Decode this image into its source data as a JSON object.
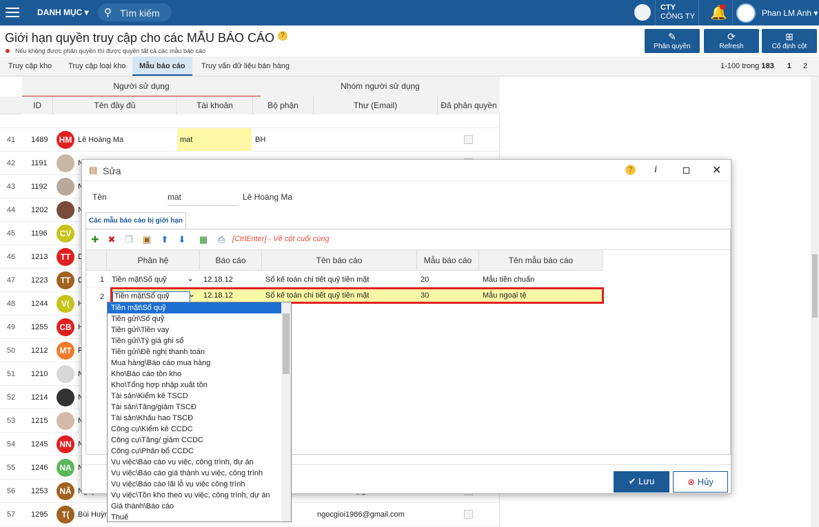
{
  "topbar": {
    "menu_label": "DANH MỤC",
    "search_placeholder": "Tìm kiếm",
    "company_line1": "CTY",
    "company_line2": "CÔNG TY",
    "user_name": "Phan LM Anh"
  },
  "page": {
    "title": "Giới hạn quyền truy cập cho các MẪU BÁO CÁO",
    "subtitle": "Nếu không được phân quyền thì được quyền tất cả các mẫu báo cáo"
  },
  "header_buttons": [
    {
      "label": "Phân quyền",
      "icon": "pencil-icon"
    },
    {
      "label": "Refresh",
      "icon": "refresh-icon"
    },
    {
      "label": "Cố định cột",
      "icon": "pin-columns-icon"
    }
  ],
  "tabs": [
    "Truy cập kho",
    "Truy cập loại kho",
    "Mẫu báo cáo",
    "Truy vấn dữ liệu bán hàng"
  ],
  "paging": {
    "range": "1-100 trong",
    "total": "183",
    "page1": "1",
    "page2": "2"
  },
  "grid": {
    "group_headers": [
      "Người sử dụng",
      "Nhóm người sử dụng"
    ],
    "columns": [
      "ID",
      "Tên đầy đủ",
      "Tài khoản",
      "Bộ phận",
      "Thư (Email)",
      "Đã phân quyền"
    ],
    "rows": [
      {
        "n": "41",
        "id": "1489",
        "initials": "HM",
        "color": "#e02020",
        "name": "Lê Hoàng Ma",
        "account": "mat",
        "dept": "BH",
        "email": ""
      },
      {
        "n": "42",
        "id": "1191",
        "initials": "",
        "color": "#c9b7a5",
        "name": "N",
        "account": "",
        "dept": "",
        "email": ""
      },
      {
        "n": "43",
        "id": "1192",
        "initials": "",
        "color": "#b8a99a",
        "name": "N",
        "account": "",
        "dept": "",
        "email": ""
      },
      {
        "n": "44",
        "id": "1202",
        "initials": "",
        "color": "#7a4b3a",
        "name": "N",
        "account": "",
        "dept": "",
        "email": ""
      },
      {
        "n": "45",
        "id": "1196",
        "initials": "CV",
        "color": "#c8c21a",
        "name": "",
        "account": "",
        "dept": "",
        "email": ""
      },
      {
        "n": "46",
        "id": "1213",
        "initials": "TT",
        "color": "#e02020",
        "name": "D",
        "account": "",
        "dept": "",
        "email": ""
      },
      {
        "n": "47",
        "id": "1223",
        "initials": "TT",
        "color": "#a0621e",
        "name": "D",
        "account": "",
        "dept": "",
        "email": ""
      },
      {
        "n": "48",
        "id": "1244",
        "initials": "V(",
        "color": "#c8c21a",
        "name": "H",
        "account": "",
        "dept": "",
        "email": ""
      },
      {
        "n": "49",
        "id": "1255",
        "initials": "CB",
        "color": "#e02020",
        "name": "H",
        "account": "",
        "dept": "",
        "email": ""
      },
      {
        "n": "50",
        "id": "1212",
        "initials": "MT",
        "color": "#f07a2a",
        "name": "P",
        "account": "",
        "dept": "",
        "email": ""
      },
      {
        "n": "51",
        "id": "1210",
        "initials": "",
        "color": "#d8d8d8",
        "name": "N",
        "account": "",
        "dept": "",
        "email": ""
      },
      {
        "n": "52",
        "id": "1214",
        "initials": "",
        "color": "#333",
        "name": "N",
        "account": "",
        "dept": "",
        "email": ""
      },
      {
        "n": "53",
        "id": "1215",
        "initials": "",
        "color": "#d4b8a8",
        "name": "N",
        "account": "",
        "dept": "",
        "email": ""
      },
      {
        "n": "54",
        "id": "1245",
        "initials": "NN",
        "color": "#e02020",
        "name": "N",
        "account": "",
        "dept": "",
        "email": ""
      },
      {
        "n": "55",
        "id": "1246",
        "initials": "NA",
        "color": "#5bb85b",
        "name": "N",
        "account": "",
        "dept": "",
        "email": ""
      },
      {
        "n": "56",
        "id": "1253",
        "initials": "NÃ",
        "color": "#a0621e",
        "name": "Nguyễn T",
        "account": "",
        "dept": "",
        "email": "test211207@gmail.com"
      },
      {
        "n": "57",
        "id": "1295",
        "initials": "T(",
        "color": "#a0621e",
        "name": "Bùi Huỳnh Thắng (HR)",
        "account": "0909045",
        "dept": "KHO",
        "email": "ngocgioi1986@gmail.com"
      }
    ]
  },
  "dialog": {
    "title": "Sửa",
    "name_label": "Tên",
    "account_value": "mat",
    "full_name": "Lê Hoàng Ma",
    "inner_tab": "Các mẫu báo cáo bị giới hạn",
    "hint": "[CtrlEnter] - Về cột cuối cùng",
    "columns": [
      "Phân hệ",
      "Báo cáo",
      "Tên báo cáo",
      "Mẫu báo cáo",
      "Tên mẫu báo cáo"
    ],
    "rows": [
      {
        "n": "1",
        "module": "Tiền mặt\\Sổ quỹ",
        "report": "12.18.12",
        "report_name": "Sổ kế toán chi tiết quỹ tiền mặt",
        "template": "20",
        "template_name": "Mẫu tiền chuẩn"
      },
      {
        "n": "2",
        "module": "Tiền mặt\\Sổ quỹ",
        "report": "12.18.12",
        "report_name": "Sổ kế toán chi tiết quỹ tiền mặt",
        "template": "30",
        "template_name": "Mẫu ngoại tệ"
      }
    ],
    "dropdown_options": [
      "Tiền mặt\\Sổ quỹ",
      "Tiền gửi\\Sổ quỹ",
      "Tiền gửi\\Tiền vay",
      "Tiền gửi\\Tỷ giá ghi sổ",
      "Tiền gửi\\Đề nghị thanh toán",
      "Mua hàng\\Báo cáo mua hàng",
      "Kho\\Báo cáo tồn kho",
      "Kho\\Tổng hợp nhập xuất tồn",
      "Tài sản\\Kiểm kê TSCD",
      "Tài sản\\Tăng/giảm TSCĐ",
      "Tài sản\\Khấu hao TSCĐ",
      "Công cụ\\Kiểm kê CCDC",
      "Công cụ\\Tăng/ giảm CCDC",
      "Công cụ\\Phân bổ CCDC",
      "Vụ việc\\Báo cáo vụ việc, công trình, dự án",
      "Vụ việc\\Báo cáo giá thành vụ việc, công trình",
      "Vụ việc\\Báo cáo lãi lỗ vụ việc công trình",
      "Vụ việc\\Tồn kho theo vụ việc, công trình, dự án",
      "Giá thành\\Báo cáo",
      "Thuế"
    ],
    "save_label": "Lưu",
    "cancel_label": "Hủy"
  },
  "colors": {
    "primary": "#1c5a96",
    "highlight": "#fdf8a6",
    "danger": "#e02020"
  }
}
